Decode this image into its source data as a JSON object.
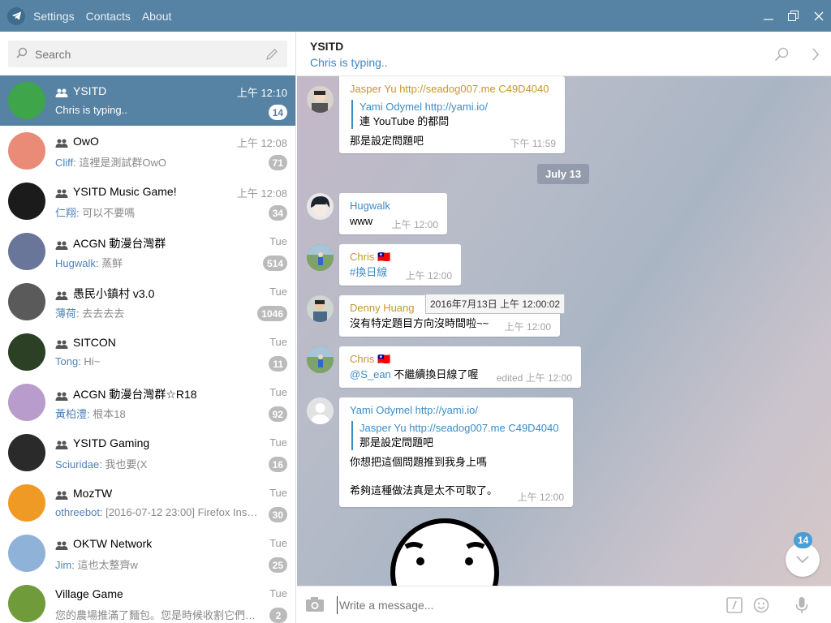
{
  "menu": {
    "settings": "Settings",
    "contacts": "Contacts",
    "about": "About"
  },
  "sidebar": {
    "search_placeholder": "Search",
    "dialogs": [
      {
        "name": "YSITD",
        "time": "上午 12:10",
        "sender": "",
        "preview": "Chris is typing..",
        "unread": "14",
        "group": true,
        "avatar_color": "#3ea54a"
      },
      {
        "name": "OwO",
        "time": "上午 12:08",
        "sender": "Cliff:",
        "preview": " 這裡是測試群OwO",
        "unread": "71",
        "group": true,
        "avatar_color": "#e98b76"
      },
      {
        "name": "YSITD Music Game!",
        "time": "上午 12:08",
        "sender": "仁翔:",
        "preview": " 可以不要嗎",
        "unread": "34",
        "group": true,
        "avatar_color": "#1b1b1b"
      },
      {
        "name": "ACGN 動漫台灣群",
        "time": "Tue",
        "sender": "Hugwalk:",
        "preview": " 蒸鲜",
        "unread": "514",
        "group": true,
        "avatar_color": "#6a7699"
      },
      {
        "name": "愚民小鎮村 v3.0",
        "time": "Tue",
        "sender": "薄荷:",
        "preview": " 去去去去",
        "unread": "1046",
        "group": true,
        "avatar_color": "#5a5a5a"
      },
      {
        "name": "SITCON",
        "time": "Tue",
        "sender": "Tong:",
        "preview": " Hi~",
        "unread": "11",
        "group": true,
        "avatar_color": "#2b4024"
      },
      {
        "name": "ACGN 動漫台灣群☆R18",
        "time": "Tue",
        "sender": "黃柏澧:",
        "preview": " 根本18",
        "unread": "92",
        "group": true,
        "avatar_color": "#b89ccb"
      },
      {
        "name": "YSITD Gaming",
        "time": "Tue",
        "sender": "Sciuridae:",
        "preview": " 我也要(X",
        "unread": "16",
        "group": true,
        "avatar_color": "#2a2a2a"
      },
      {
        "name": "MozTW",
        "time": "Tue",
        "sender": "othreebot:",
        "preview": " [2016-07-12 23:00] Firefox Inst...",
        "unread": "30",
        "group": true,
        "avatar_color": "#f09a26"
      },
      {
        "name": "OKTW Network",
        "time": "Tue",
        "sender": "Jim:",
        "preview": " 這也太整齊w",
        "unread": "25",
        "group": true,
        "avatar_color": "#8fb3d8"
      },
      {
        "name": "Village Game",
        "time": "Tue",
        "sender": "",
        "preview": "您的農場推滿了麵包。您是時候收割它們了...",
        "unread": "2",
        "group": false,
        "avatar_color": "#6f9b3a"
      }
    ]
  },
  "chat": {
    "title": "YSITD",
    "status": "Chris is typing..",
    "messages": {
      "m1": {
        "author": "Jasper Yu http://seadog007.me C49D4040",
        "reply_author": "Yami Odymel http://yami.io/",
        "reply_text": "連 YouTube 的都問",
        "text": "那是設定問題吧",
        "time": "下午 11:59"
      },
      "date": "July 13",
      "m2": {
        "author": "Hugwalk",
        "text": "www",
        "time": "上午 12:00"
      },
      "m3": {
        "author": "Chris 🇹🇼",
        "text": "#換日線",
        "time": "上午 12:00"
      },
      "m4": {
        "author": "Denny Huang",
        "text": "沒有特定題目方向沒時間啦~~",
        "time": "上午 12:00",
        "tooltip": "2016年7月13日 上午 12:00:02"
      },
      "m5": {
        "author": "Chris 🇹🇼",
        "mention": "@S_ean",
        "text": " 不繼續換日線了喔",
        "time": "edited 上午 12:00"
      },
      "m6": {
        "author": "Yami Odymel http://yami.io/",
        "reply_author": "Jasper Yu http://seadog007.me C49D4040",
        "reply_text": "那是設定問題吧",
        "text1": "你想把這個問題推到我身上嗎",
        "text2": "希夠這種做法真是太不可取了。",
        "time": "上午 12:00"
      }
    },
    "scroll_unread": "14",
    "composer_placeholder": "Write a message..."
  },
  "colors": {
    "accent": "#5682a3",
    "link": "#3b8cc4",
    "gold": "#c89528",
    "badge": "#bbbbbb"
  }
}
